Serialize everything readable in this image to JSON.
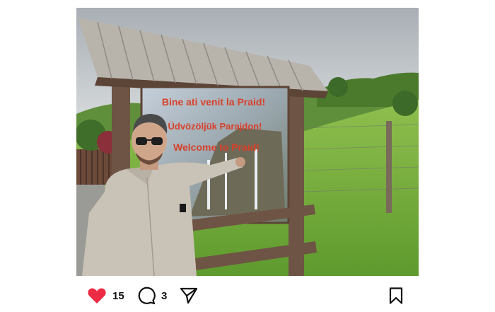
{
  "post": {
    "image_alt": "Man pointing at a wooden welcome sign in a green landscape",
    "sign_lines": [
      "Bine ati venit la Praid!",
      "Üdvözöljük Parajdon!",
      "Welcome to Praid!"
    ]
  },
  "actions": {
    "like_count": "15",
    "comment_count": "3"
  },
  "colors": {
    "like": "#ed2b45",
    "icon": "#111111",
    "sign_text": "#d9402a"
  },
  "icons": {
    "like": "heart-filled-icon",
    "comment": "comment-bubble-icon",
    "share": "paper-plane-icon",
    "save": "bookmark-icon"
  }
}
